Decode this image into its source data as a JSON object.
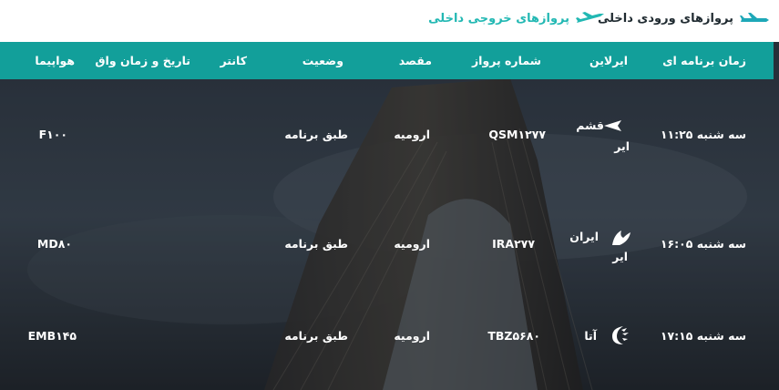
{
  "tabs": {
    "inbound_label": "پروازهای ورودی داخلی",
    "outbound_label": "پروازهای خروجی داخلی"
  },
  "colors": {
    "accent": "#129f9a",
    "active_tab": "#22b8b3",
    "text_dark": "#1f2a30"
  },
  "columns": {
    "scheduled": "زمان برنامه ای",
    "airline": "ایرلاین",
    "flight_no": "شماره پرواز",
    "destination": "مقصد",
    "status": "وضعیت",
    "counter": "کانتر",
    "actual": "تاریخ و زمان واق",
    "aircraft": "هواپیما"
  },
  "flights": [
    {
      "time": "سه شنبه ۱۱:۲۵",
      "airline_line1": "قشم",
      "airline_line2": "ایر",
      "airline_logo": "qeshm-air-logo",
      "flight_no": "QSM۱۲۷۷",
      "destination": "ارومیه",
      "status": "طبق برنامه",
      "aircraft": "F۱۰۰"
    },
    {
      "time": "سه شنبه ۱۶:۰۵",
      "airline_line1": "ایران",
      "airline_line2": "ایر",
      "airline_logo": "iran-air-logo",
      "flight_no": "IRA۲۷۷",
      "destination": "ارومیه",
      "status": "طبق برنامه",
      "aircraft": "MD۸۰"
    },
    {
      "time": "سه شنبه ۱۷:۱۵",
      "airline_line1": "آتا",
      "airline_line2": "",
      "airline_logo": "ata-airlines-logo",
      "flight_no": "TBZ۵۶۸۰",
      "destination": "ارومیه",
      "status": "طبق برنامه",
      "aircraft": "EMB۱۴۵"
    }
  ]
}
